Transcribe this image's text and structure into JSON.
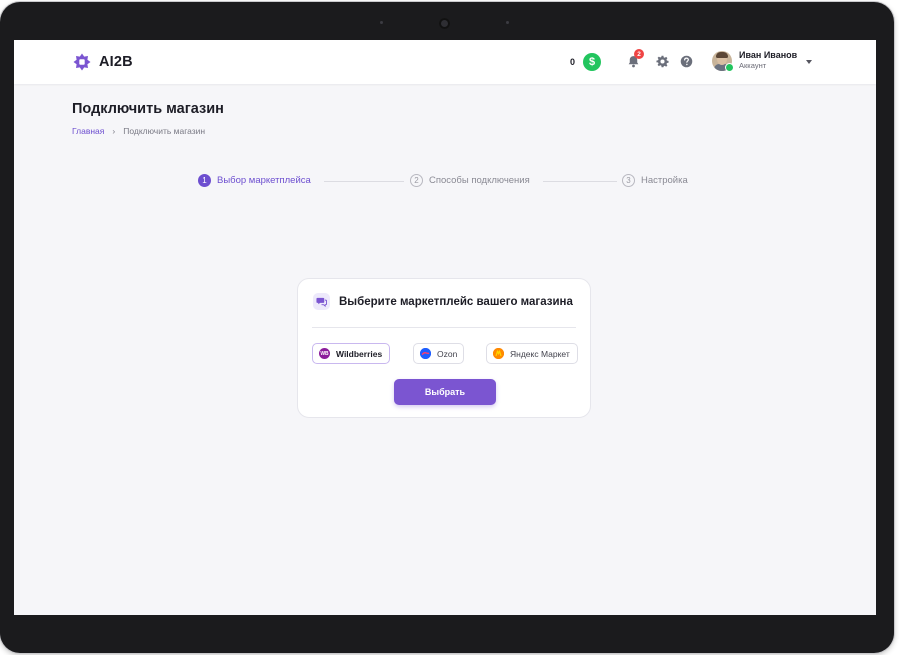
{
  "app": {
    "logo_text": "AI2B"
  },
  "header": {
    "balance": "0",
    "currency_symbol": "$",
    "notifications_count": "2",
    "user": {
      "name": "Иван Иванов",
      "role": "Аккаунт"
    }
  },
  "page": {
    "title": "Подключить магазин",
    "breadcrumb": {
      "home": "Главная",
      "separator": "›",
      "current": "Подключить магазин"
    }
  },
  "stepper": {
    "steps": [
      {
        "number": "1",
        "label": "Выбор маркетплейса",
        "active": true
      },
      {
        "number": "2",
        "label": "Способы подключения",
        "active": false
      },
      {
        "number": "3",
        "label": "Настройка",
        "active": false
      }
    ]
  },
  "card": {
    "title": "Выберите маркетплейс вашего магазина",
    "marketplaces": [
      {
        "label": "Wildberries",
        "logo_text": "WB",
        "color": "#8b1d9b",
        "selected": true
      },
      {
        "label": "Ozon",
        "logo_text": "",
        "color": "#1e5eff",
        "selected": false
      },
      {
        "label": "Яндекс Маркет",
        "logo_text": "",
        "color": "#ff6a00",
        "selected": false
      }
    ],
    "submit_label": "Выбрать"
  },
  "colors": {
    "accent": "#7b55d1",
    "success": "#22c55e",
    "danger": "#ef4444"
  },
  "icons": [
    "logo-icon",
    "dollar-icon",
    "bell-icon",
    "gear-icon",
    "help-icon",
    "chevron-down-icon",
    "chat-icon"
  ]
}
